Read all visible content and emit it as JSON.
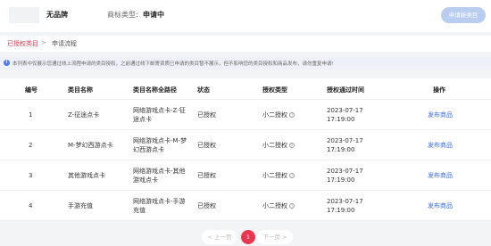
{
  "header": {
    "brand_name": "无品牌",
    "brand_type_label": "商标类型:",
    "brand_type_value": "申请中",
    "apply_button": "申请新类目"
  },
  "tabs": {
    "active": "已授权类目",
    "separator": ">",
    "second": "申请流程"
  },
  "notice": {
    "icon": "info-icon",
    "text": "本列表中仅展示您通过线上流程申请的类目授权，之前通过线下邮寄资质已申请的类目暂不展示，但不影响您的类目授权和商品发布，请勿重复申请!"
  },
  "table": {
    "columns": [
      "编号",
      "类目名称",
      "类目名称全路径",
      "状态",
      "授权类型",
      "授权通过时间",
      "操作"
    ],
    "rows": [
      {
        "index": "1",
        "name": "Z-征途点卡",
        "path": "网络游戏点卡-Z-征途点卡",
        "status": "已授权",
        "auth_type": "小二授权",
        "time": "2023-07-17 17:19:00",
        "action": "发布商品"
      },
      {
        "index": "2",
        "name": "M-梦幻西游点卡",
        "path": "网络游戏点卡-M-梦幻西游点卡",
        "status": "已授权",
        "auth_type": "小二授权",
        "time": "2023-07-17 17:19:00",
        "action": "发布商品"
      },
      {
        "index": "3",
        "name": "其他游戏点卡",
        "path": "网络游戏点卡-其他游戏点卡",
        "status": "已授权",
        "auth_type": "小二授权",
        "time": "2023-07-17 17:19:00",
        "action": "发布商品"
      },
      {
        "index": "4",
        "name": "手游充值",
        "path": "网络游戏点卡-手游充值",
        "status": "已授权",
        "auth_type": "小二授权",
        "time": "2023-07-17 17:19:00",
        "action": "发布商品"
      }
    ]
  },
  "pagination": {
    "prev": "< 上一页",
    "current": "1",
    "next": "下一页 >"
  },
  "colors": {
    "accent": "#e8364f",
    "link": "#3a6fe6",
    "button_disabled": "#b9cdf1"
  }
}
